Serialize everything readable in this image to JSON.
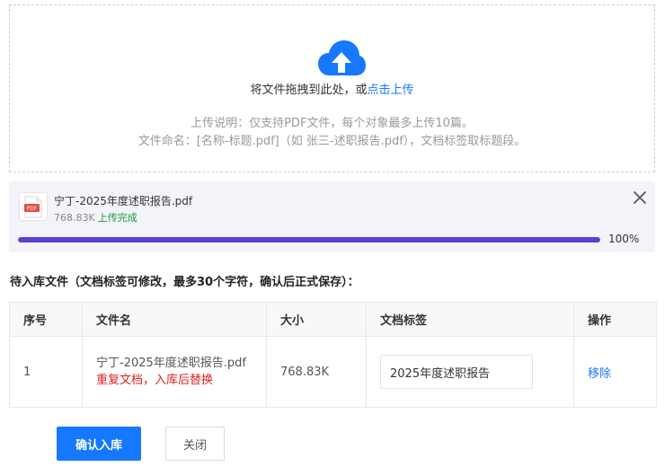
{
  "upload": {
    "drop_text": "将文件拖拽到此处，或",
    "drop_link": "点击上传",
    "hint_line1": "上传说明：仅支持PDF文件，每个对象最多上传10篇。",
    "hint_line2": "文件命名：[名称-标题.pdf]（如 张三-述职报告.pdf），文档标签取标题段。",
    "icon": "cloud-upload-icon",
    "accent_color": "#1677ff"
  },
  "file_card": {
    "icon_label": "PDF",
    "name": "宁丁-2025年度述职报告.pdf",
    "size": "768.83K",
    "status": "上传完成",
    "progress_percent": 100,
    "progress_text": "100%",
    "progress_color": "#5a3fd6",
    "status_color": "#1c9a3a"
  },
  "pending": {
    "title": "待入库文件（文档标签可修改，最多30个字符，确认后正式保存）：",
    "columns": [
      "序号",
      "文件名",
      "大小",
      "文档标签",
      "操作"
    ],
    "rows": [
      {
        "index": "1",
        "filename": "宁丁-2025年度述职报告.pdf",
        "warning": "重复文档，入库后替换",
        "size": "768.83K",
        "tag_value": "2025年度述职报告",
        "action": "移除"
      }
    ]
  },
  "buttons": {
    "confirm": "确认入库",
    "close": "关闭"
  }
}
